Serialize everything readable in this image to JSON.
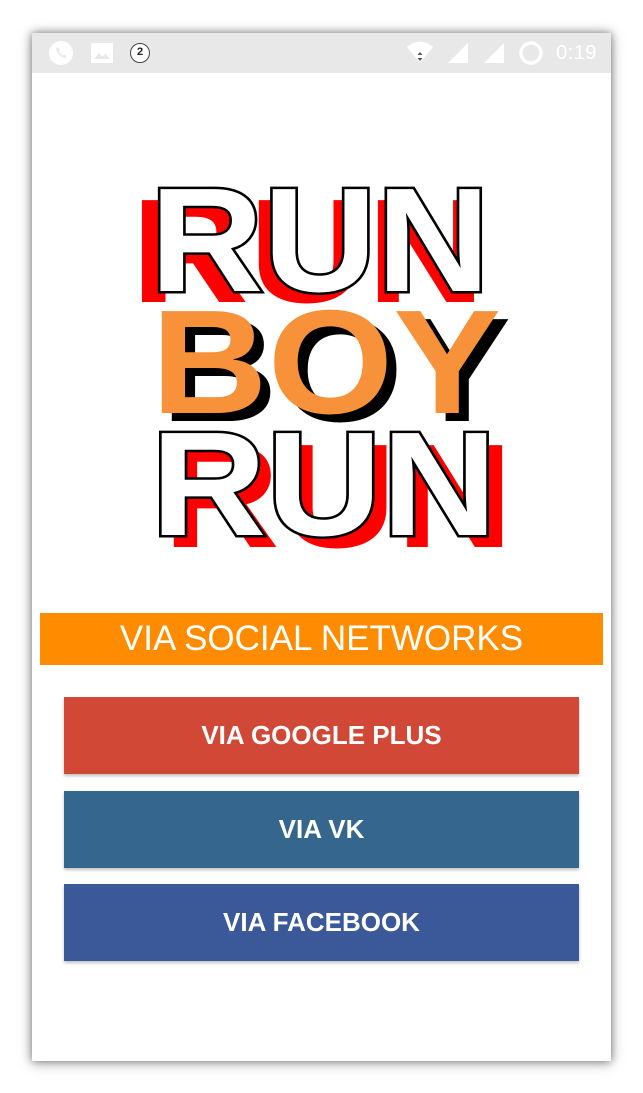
{
  "status_bar": {
    "time": "0:19",
    "notification_count": "2",
    "icons": [
      "phone-icon",
      "image-icon",
      "notification-count-icon",
      "wifi-icon",
      "signal-icon",
      "signal-icon",
      "loading-icon"
    ]
  },
  "logo": {
    "lines": [
      "RUN",
      "BOY",
      "RUN"
    ],
    "colors": {
      "red_shadow": "#ff0000",
      "orange": "#f7923a",
      "outline": "#000000",
      "fill": "#ffffff"
    }
  },
  "section": {
    "title": "VIA SOCIAL NETWORKS",
    "color": "#ff8c00"
  },
  "buttons": {
    "google": {
      "label": "VIA GOOGLE PLUS",
      "color": "#d14836"
    },
    "vk": {
      "label": "VIA VK",
      "color": "#35668e"
    },
    "facebook": {
      "label": "VIA FACEBOOK",
      "color": "#3b5998"
    }
  }
}
